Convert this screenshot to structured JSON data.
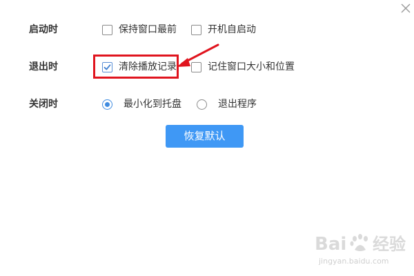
{
  "settings": {
    "startup": {
      "label": "启动时",
      "options": [
        {
          "label": "保持窗口最前",
          "checked": false
        },
        {
          "label": "开机自启动",
          "checked": false
        }
      ]
    },
    "exit": {
      "label": "退出时",
      "options": [
        {
          "label": "清除播放记录",
          "checked": true
        },
        {
          "label": "记住窗口大小和位置",
          "checked": false
        }
      ]
    },
    "close": {
      "label": "关闭时",
      "options": [
        {
          "label": "最小化到托盘",
          "selected": true
        },
        {
          "label": "退出程序",
          "selected": false
        }
      ]
    }
  },
  "reset_button": {
    "label": "恢复默认"
  },
  "annotation": {
    "color": "#e0141e",
    "shape": "rectangle-with-arrow"
  },
  "accent_color": "#3f98f5",
  "watermark": {
    "brand": "Baidu经验",
    "url": "jingyan.baidu.com"
  }
}
